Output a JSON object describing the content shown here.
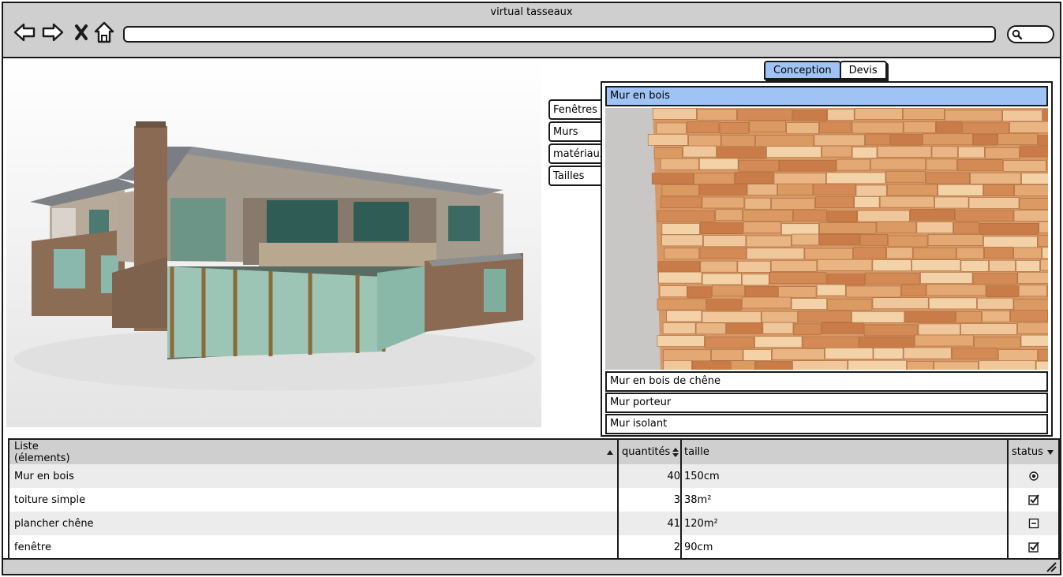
{
  "window": {
    "title": "virtual tasseaux"
  },
  "toolbar": {
    "back_icon": "arrow-left-icon",
    "forward_icon": "arrow-right-icon",
    "stop_icon": "close-icon",
    "home_icon": "home-icon",
    "url_value": "",
    "search_icon": "search-icon"
  },
  "top_tabs": [
    {
      "label": "Conception",
      "active": true
    },
    {
      "label": "Devis",
      "active": false
    }
  ],
  "side_tabs": [
    {
      "label": "Fenêtres"
    },
    {
      "label": "Murs"
    },
    {
      "label": "matériaux"
    },
    {
      "label": "Tailles"
    }
  ],
  "accordion": {
    "items": [
      {
        "label": "Mur en bois",
        "expanded": true
      },
      {
        "label": "Mur en bois de chêne",
        "expanded": false
      },
      {
        "label": "Mur porteur",
        "expanded": false
      },
      {
        "label": "Mur isolant",
        "expanded": false
      }
    ]
  },
  "table": {
    "headers": {
      "col1_line1": "Liste",
      "col1_line2": "(élements)",
      "col2": "quantités",
      "col3": "taille",
      "col4": "status"
    },
    "rows": [
      {
        "name": "Mur en bois",
        "quantity": "40",
        "size": "150cm",
        "status": "radio-selected"
      },
      {
        "name": "toiture simple",
        "quantity": "3",
        "size": "38m²",
        "status": "checkbox-checked"
      },
      {
        "name": "plancher chêne",
        "quantity": "41",
        "size": "120m²",
        "status": "checkbox-indeterminate"
      },
      {
        "name": "fenêtre",
        "quantity": "2",
        "size": "90cm",
        "status": "checkbox-checked"
      }
    ]
  },
  "colors": {
    "accent": "#9fc3f4",
    "chrome": "#cfcfcf",
    "row_alt": "#ececec",
    "border": "#1a1a1a"
  }
}
